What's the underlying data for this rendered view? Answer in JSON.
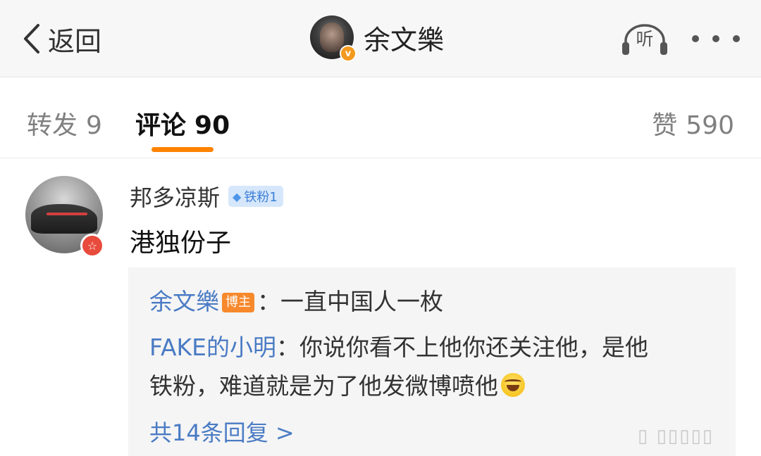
{
  "nav": {
    "back_label": "返回",
    "profile_name": "余文樂",
    "verified_badge": "v",
    "listen_label": "听"
  },
  "tabs": {
    "repost_label": "转发",
    "repost_count": "9",
    "comments_label": "评论",
    "comments_count": "90",
    "likes_label": "赞",
    "likes_count": "590",
    "active": "comments",
    "accent_color": "#ff8200"
  },
  "comment": {
    "username": "邦多凉斯",
    "fan_badge": "铁粉1",
    "text": "港独份子"
  },
  "replies": [
    {
      "name": "余文樂",
      "badge": "博主",
      "text": "：一直中国人一枚"
    },
    {
      "name": "FAKE的小明",
      "text": "：你说你看不上他你还关注他，是他",
      "text_cont": "铁粉，难道就是为了他发微博喷他",
      "emoji": "laughing-tears"
    }
  ],
  "more_replies": "共14条回复 >",
  "link_color": "#4a7bc4"
}
